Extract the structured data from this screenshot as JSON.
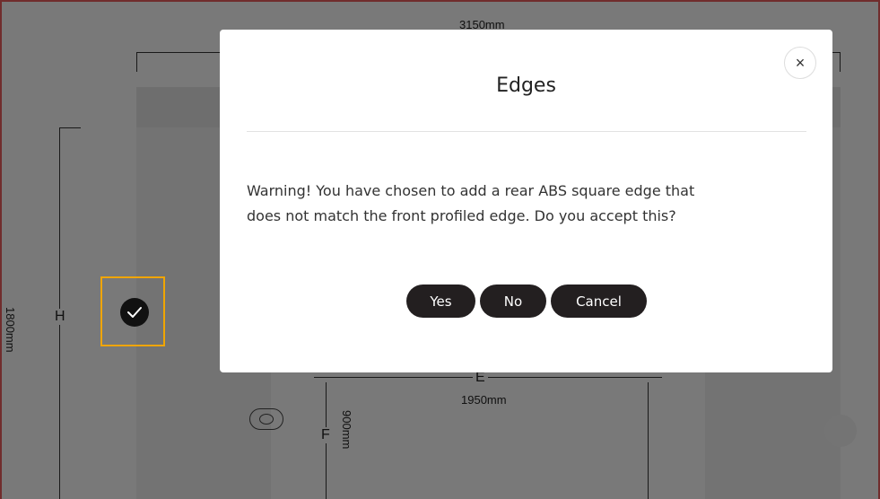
{
  "drawing": {
    "dim_top": "3150mm",
    "dim_left": "1800mm",
    "label_h": "H",
    "label_e": "E",
    "dim_middle": "1950mm",
    "label_f": "F",
    "dim_small": "900mm"
  },
  "selection": {
    "check_icon": "check-icon",
    "accent_color": "#f0a500"
  },
  "modal": {
    "title": "Edges",
    "message_line1": "Warning! You have chosen to add a rear ABS square edge that",
    "message_line2": "does not match the front profiled edge. Do you accept this?",
    "close_symbol": "×",
    "buttons": {
      "yes": "Yes",
      "no": "No",
      "cancel": "Cancel"
    },
    "button_color": "#231f20"
  }
}
